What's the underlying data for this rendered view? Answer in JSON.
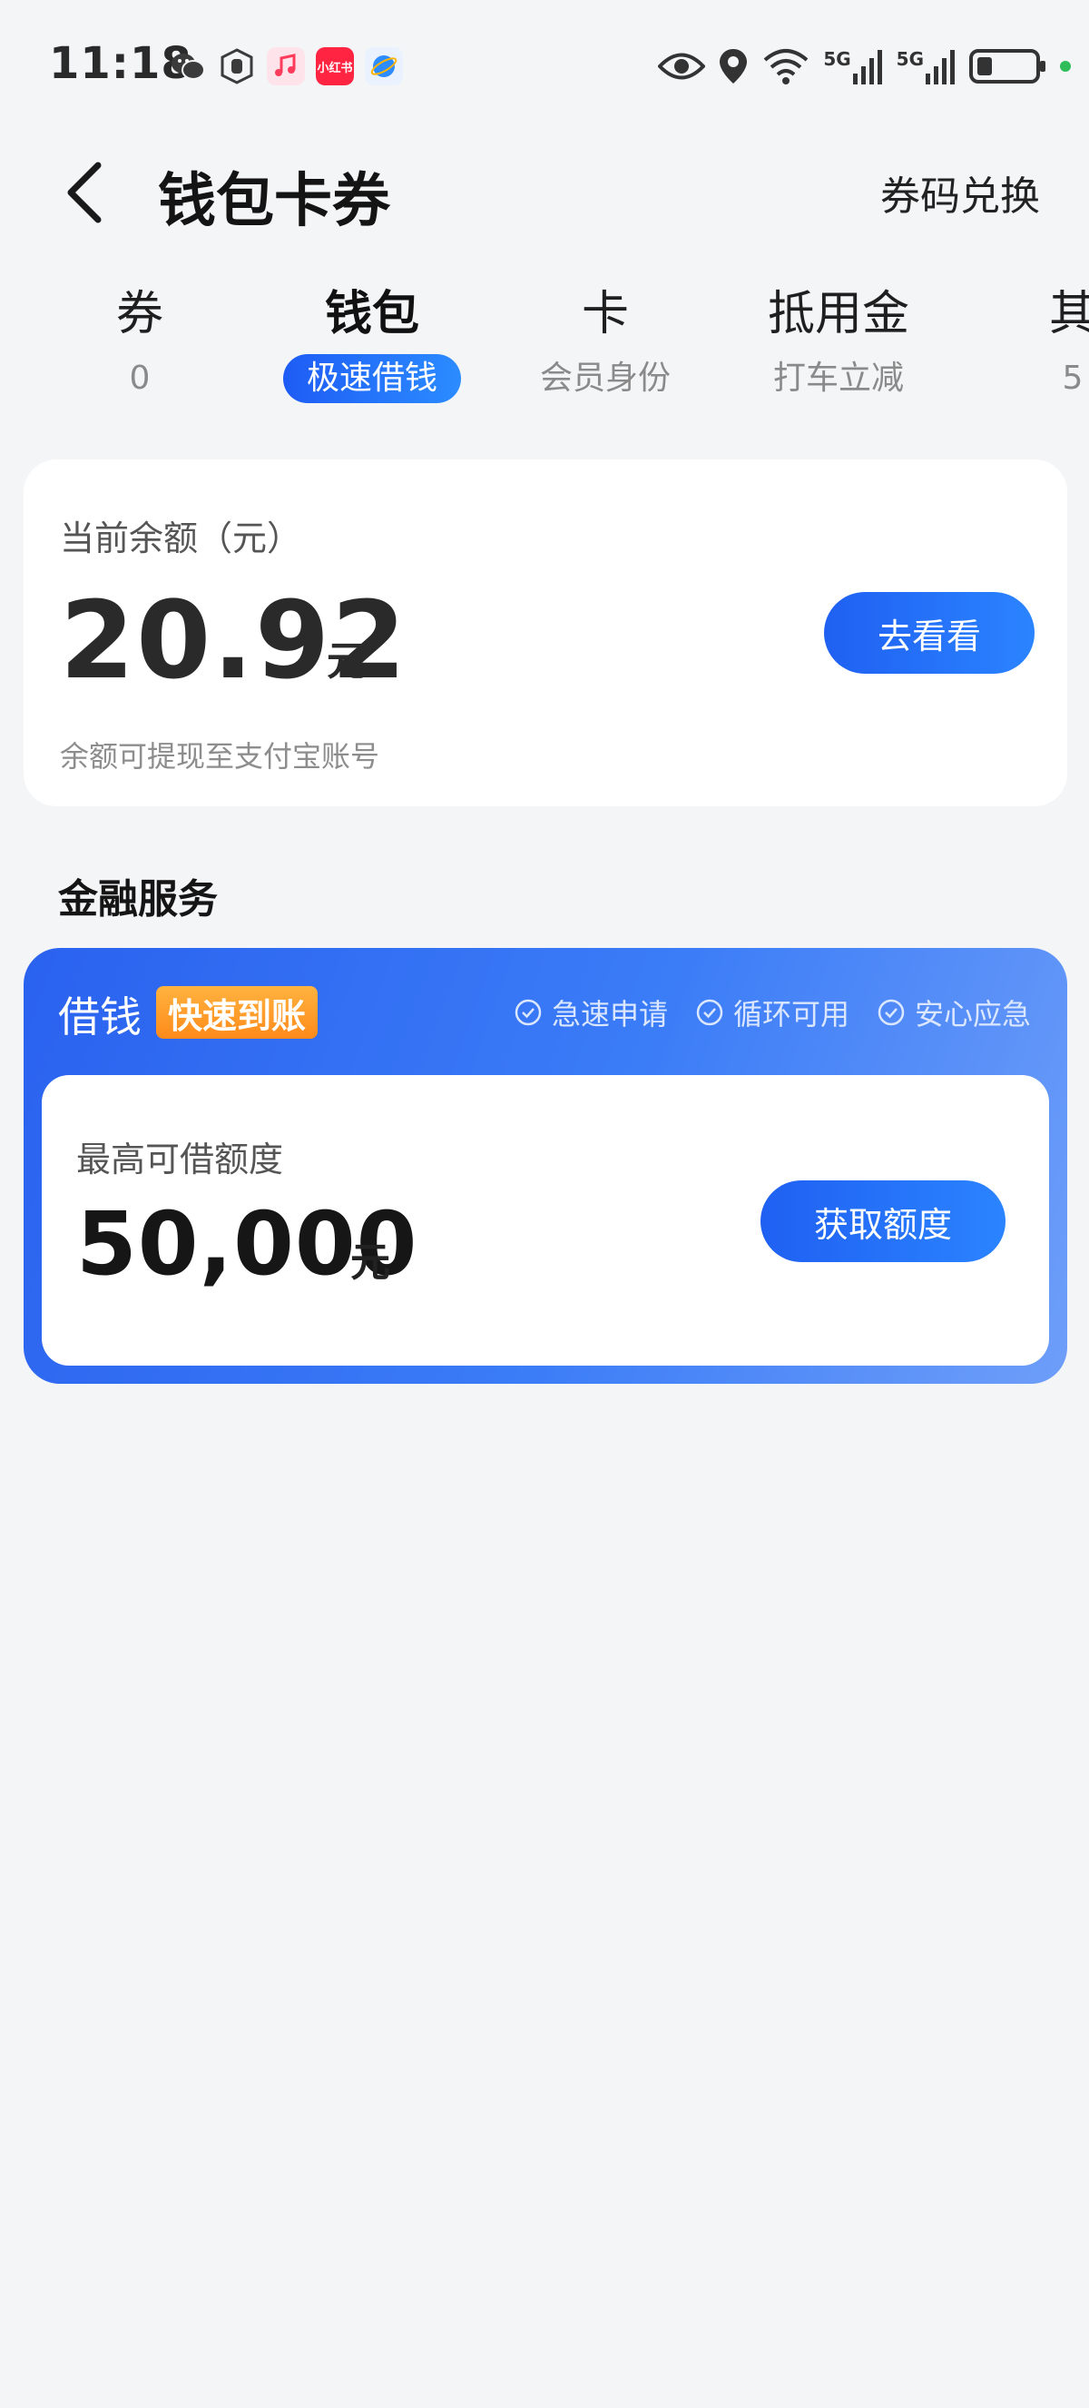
{
  "status_bar": {
    "time": "11:18",
    "app_icons": [
      {
        "name": "wechat-icon",
        "color": "#3b3b3b",
        "text": ""
      },
      {
        "name": "shield-hand-icon",
        "color": "#3b3b3b",
        "text": ""
      },
      {
        "name": "music-icon",
        "color": "#ffdce4",
        "text": ""
      },
      {
        "name": "xiaohongshu-icon",
        "color": "#ff2442",
        "text": "小红书"
      },
      {
        "name": "browser-icon",
        "color": "#e8f0ff",
        "text": ""
      }
    ],
    "network": "5G",
    "network_2": "5G",
    "online_color": "#2ebd59"
  },
  "header": {
    "title": "钱包卡券",
    "redeem": "券码兑换"
  },
  "tabs": [
    {
      "title": "券",
      "sub": "0"
    },
    {
      "title": "钱包",
      "sub": "极速借钱"
    },
    {
      "title": "卡",
      "sub": "会员身份"
    },
    {
      "title": "抵用金",
      "sub": "打车立减"
    },
    {
      "title": "其",
      "sub": "5"
    }
  ],
  "balance": {
    "label": "当前余额（元）",
    "amount": "20.92",
    "unit": "元",
    "note": "余额可提现至支付宝账号",
    "button": "去看看"
  },
  "finance": {
    "section_title": "金融服务",
    "loan_title": "借钱",
    "tag": "快速到账",
    "features": [
      "急速申请",
      "循环可用",
      "安心应急"
    ],
    "limit_label": "最高可借额度",
    "limit_amount": "50,000",
    "limit_unit": "元",
    "button": "获取额度"
  },
  "colors": {
    "accent": "#1f60f2",
    "tag_orange": "#ff8a1a",
    "background": "#f4f5f7"
  }
}
